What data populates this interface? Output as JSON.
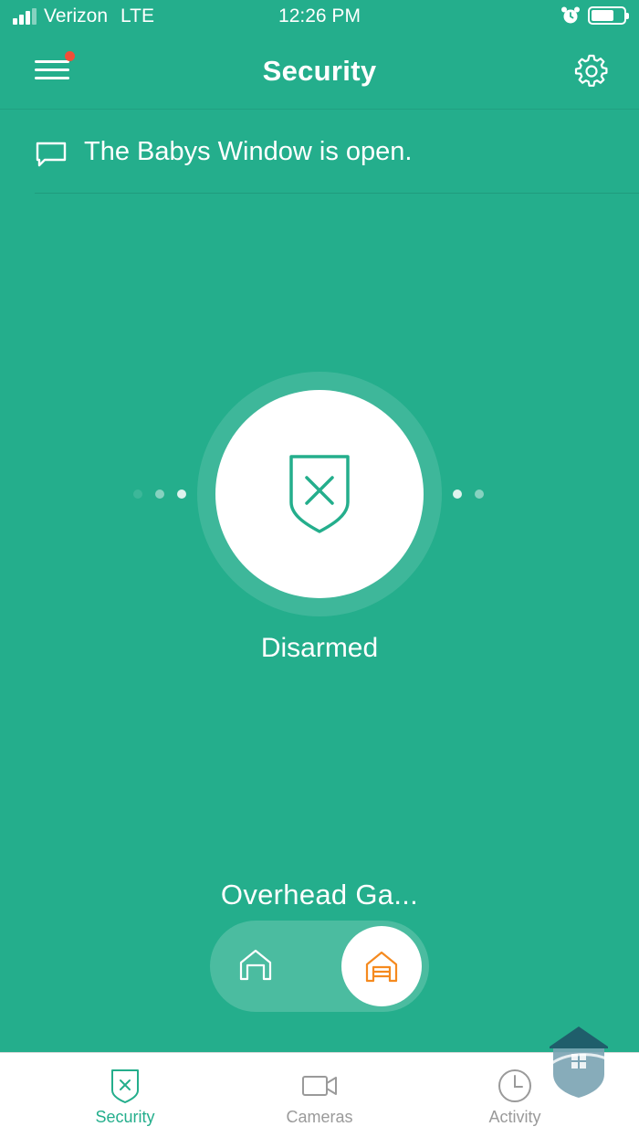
{
  "status_bar": {
    "carrier": "Verizon",
    "network": "LTE",
    "time": "12:26 PM"
  },
  "nav": {
    "title": "Security",
    "menu_has_notification": true
  },
  "notice": {
    "message": "The Babys Window is open."
  },
  "security": {
    "status": "Disarmed",
    "icon": "shield-x-icon"
  },
  "garage": {
    "device_name": "Overhead Ga...",
    "state_selected": "closed"
  },
  "tabs": [
    {
      "label": "Security",
      "icon": "shield-x-icon",
      "active": true
    },
    {
      "label": "Cameras",
      "icon": "video-camera-icon",
      "active": false
    },
    {
      "label": "Activity",
      "icon": "clock-icon",
      "active": false
    }
  ],
  "colors": {
    "brand_green": "#24ae8c",
    "notification_red": "#f04e37",
    "garage_orange": "#f58a1f",
    "inactive_gray": "#9a9a9a"
  }
}
